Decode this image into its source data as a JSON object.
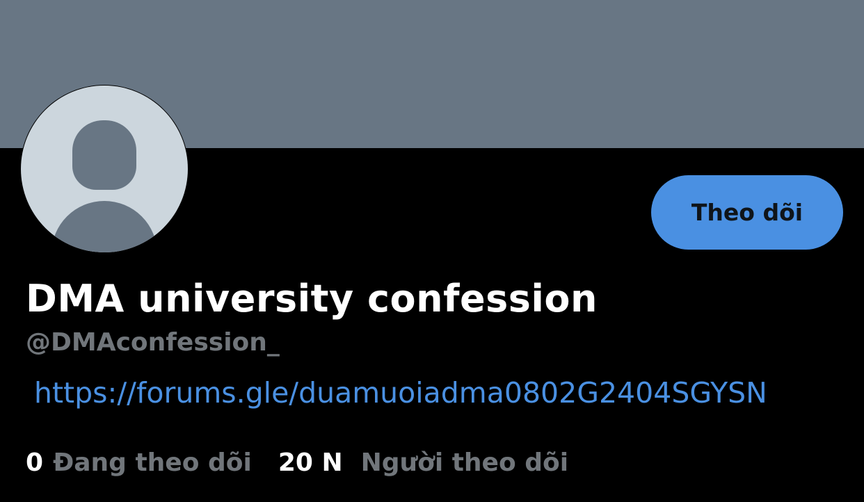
{
  "colors": {
    "banner": "#687684",
    "background": "#000000",
    "accent": "#4a90e2",
    "avatar_bg": "#ccd6dd",
    "muted_text": "#71767b"
  },
  "profile": {
    "avatar_icon": "default-avatar-icon",
    "follow_label": "Theo dõi",
    "display_name": "DMA university confession",
    "handle": "@DMAconfession_",
    "bio_link": "https://forums.gle/duamuoiadma0802G2404SGYSN"
  },
  "stats": {
    "following_count": "0",
    "following_label": "Đang theo dõi",
    "followers_count": "20 N",
    "followers_label": "Người theo dõi"
  }
}
